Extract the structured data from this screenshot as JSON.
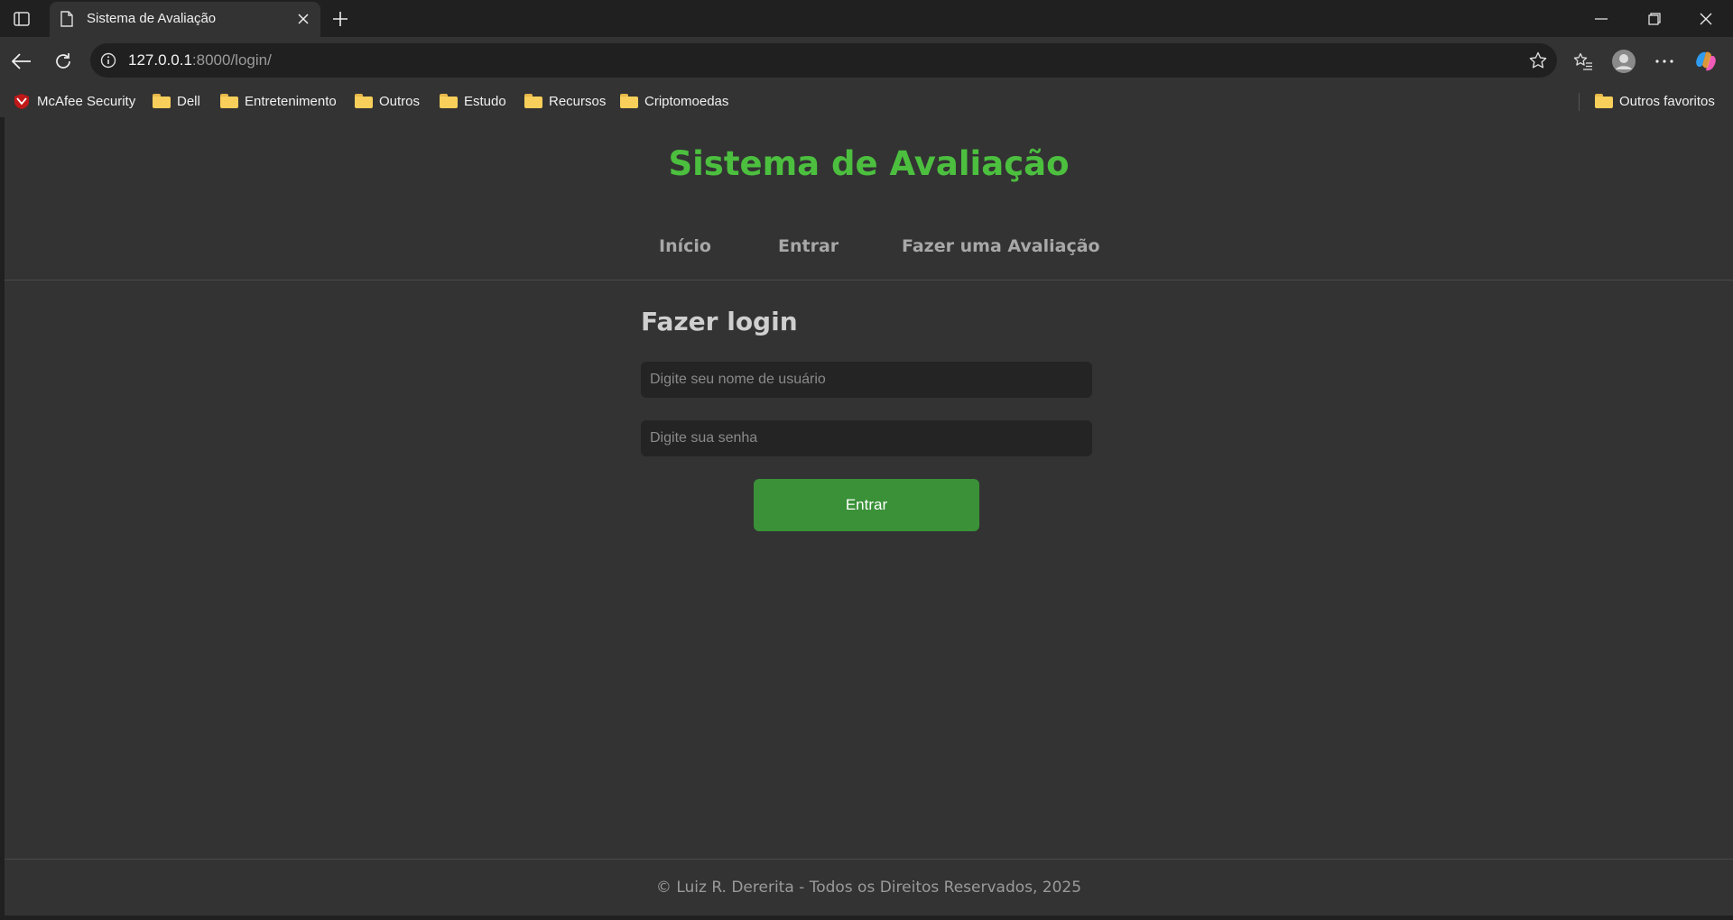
{
  "browser": {
    "tab_title": "Sistema de Avaliação",
    "url_host": "127.0.0.1",
    "url_rest": ":8000/login/",
    "bookmarks": [
      "McAfee Security",
      "Dell",
      "Entretenimento",
      "Outros",
      "Estudo",
      "Recursos",
      "Criptomoedas"
    ],
    "other_favorites": "Outros favoritos",
    "icons": [
      "sidebar-icon",
      "page-icon",
      "close-icon",
      "plus-icon",
      "minimize-icon",
      "restore-icon",
      "back-icon",
      "refresh-icon",
      "info-icon",
      "star-icon",
      "favorites-icon",
      "profile-icon",
      "more-icon",
      "copilot-icon",
      "mcafee-icon",
      "folder-icon"
    ]
  },
  "page": {
    "title": "Sistema de Avaliação",
    "nav": [
      "Início",
      "Entrar",
      "Fazer uma Avaliação"
    ],
    "login_heading": "Fazer login",
    "username_placeholder": "Digite seu nome de usuário",
    "password_placeholder": "Digite sua senha",
    "submit_label": "Entrar",
    "footer": "© Luiz R. Dererita - Todos os Direitos Reservados, 2025"
  },
  "colors": {
    "accent_green": "#4cbf3f",
    "button_green": "#3a9138",
    "page_bg": "#333333"
  }
}
